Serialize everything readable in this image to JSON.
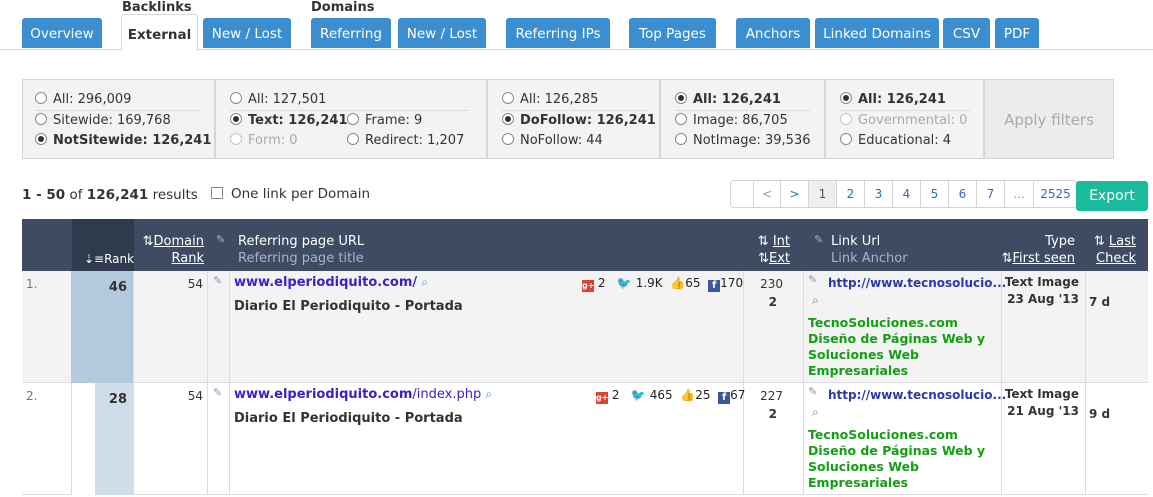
{
  "nav": {
    "group_backlinks": "Backlinks",
    "group_domains": "Domains",
    "tabs": [
      {
        "label": "Overview"
      },
      {
        "label": "External"
      },
      {
        "label": "New / Lost"
      },
      {
        "label": "Referring"
      },
      {
        "label": "New / Lost"
      },
      {
        "label": "Referring IPs"
      },
      {
        "label": "Top Pages"
      },
      {
        "label": "Anchors"
      },
      {
        "label": "Linked Domains"
      },
      {
        "label": "CSV"
      },
      {
        "label": "PDF"
      }
    ]
  },
  "filters": {
    "g1": {
      "all": "All: 296,009",
      "sitewide": "Sitewide: 169,768",
      "notsitewide": "NotSitewide: 126,241"
    },
    "g2": {
      "all": "All: 127,501",
      "text": "Text: 126,241",
      "frame": "Frame: 9",
      "form": "Form: 0",
      "redirect": "Redirect: 1,207"
    },
    "g3": {
      "all": "All: 126,285",
      "dofollow": "DoFollow: 126,241",
      "nofollow": "NoFollow: 44"
    },
    "g4": {
      "all": "All: 126,241",
      "image": "Image: 86,705",
      "notimage": "NotImage: 39,536"
    },
    "g5": {
      "all": "All: 126,241",
      "governmental": "Governmental: 0",
      "educational": "Educational: 4"
    },
    "apply": "Apply filters"
  },
  "results": {
    "range": "1 - 50",
    "of": "of",
    "total": "126,241",
    "label": "results",
    "one_link": "One link per Domain"
  },
  "pager": {
    "prev": "<",
    "next": ">",
    "pages": [
      "1",
      "2",
      "3",
      "4",
      "5",
      "6",
      "7"
    ],
    "ellipsis": "...",
    "last": "2525",
    "current": "1"
  },
  "export": "Export",
  "header": {
    "rank": "Rank",
    "domain": "Domain",
    "domain2": "Rank",
    "ref_url": "Referring page URL",
    "ref_title": "Referring page title",
    "int": "Int",
    "ext": "Ext",
    "link_url": "Link Url",
    "link_anchor": "Link Anchor",
    "type": "Type",
    "first_seen": "First seen",
    "last": "Last",
    "check": "Check"
  },
  "rows": [
    {
      "num": "1.",
      "rank": "46",
      "rank_fill": 1.0,
      "domain_rank": "54",
      "url_domain": "www.elperiodiquito.com/",
      "url_path": "",
      "title": "Diario El Periodiquito - Portada",
      "gplus": "2",
      "twitter": "1.9K",
      "likes": "65",
      "facebook": "170",
      "int": "230",
      "ext": "2",
      "link_url": "http://www.tecnosolucio...",
      "anchor": "TecnoSoluciones.com  Diseño de Páginas Web y Soluciones Web Empresariales",
      "type": "Text Image",
      "first_seen": "23 Aug '13",
      "last_check": "7 d"
    },
    {
      "num": "2.",
      "rank": "28",
      "rank_fill": 0.61,
      "domain_rank": "54",
      "url_domain": "www.elperiodiquito.com",
      "url_path": "/index.php",
      "title": "Diario El Periodiquito - Portada",
      "gplus": "2",
      "twitter": "465",
      "likes": "25",
      "facebook": "67",
      "int": "227",
      "ext": "2",
      "link_url": "http://www.tecnosolucio...",
      "anchor": "TecnoSoluciones.com  Diseño de Páginas Web y Soluciones Web Empresariales",
      "type": "Text Image",
      "first_seen": "21 Aug '13",
      "last_check": "9 d"
    }
  ],
  "colors": {
    "tab": "#3b8ed0",
    "header": "#3f4b62",
    "export": "#1abc9c",
    "anchor": "#12a012",
    "link": "#3a22c8"
  }
}
